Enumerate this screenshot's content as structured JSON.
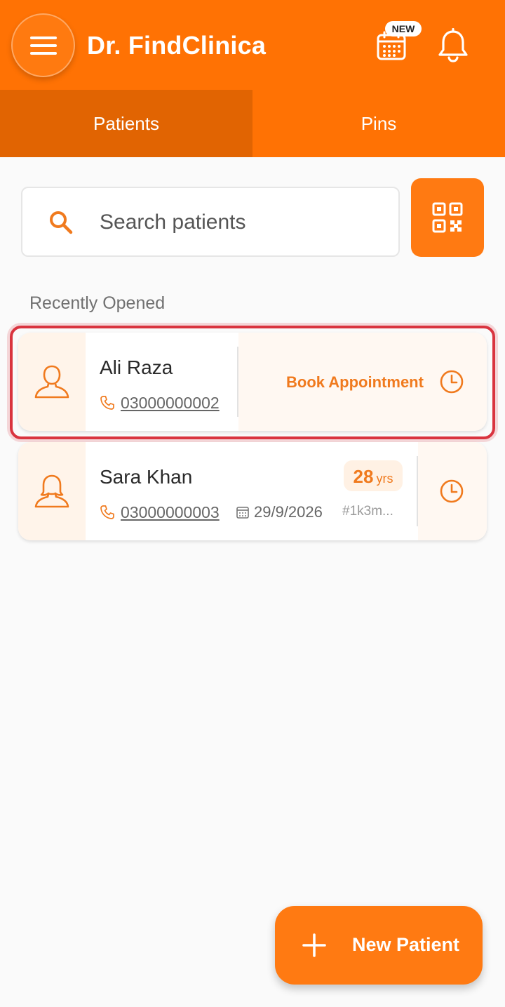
{
  "header": {
    "title": "Dr. FindClinica",
    "calendar_badge": "NEW",
    "menu_icon": "menu-icon",
    "calendar_icon": "calendar-icon",
    "bell_icon": "bell-icon"
  },
  "tabs": [
    {
      "label": "Patients",
      "active": true
    },
    {
      "label": "Pins",
      "active": false
    }
  ],
  "search": {
    "placeholder": "Search patients",
    "value": ""
  },
  "section": {
    "recent_label": "Recently Opened"
  },
  "patients": [
    {
      "name": "Ali Raza",
      "phone": "03000000002",
      "action": "Book Appointment"
    },
    {
      "name": "Sara Khan",
      "age": "28",
      "age_unit": "yrs",
      "phone": "03000000003",
      "date": "29/9/2026",
      "id_text": "#1k3m..."
    }
  ],
  "fab": {
    "label": "New Patient"
  },
  "colors": {
    "primary": "#ff7204",
    "tab_active": "#e16402",
    "accent_text": "#f07a1e",
    "highlight": "#d9343f"
  }
}
